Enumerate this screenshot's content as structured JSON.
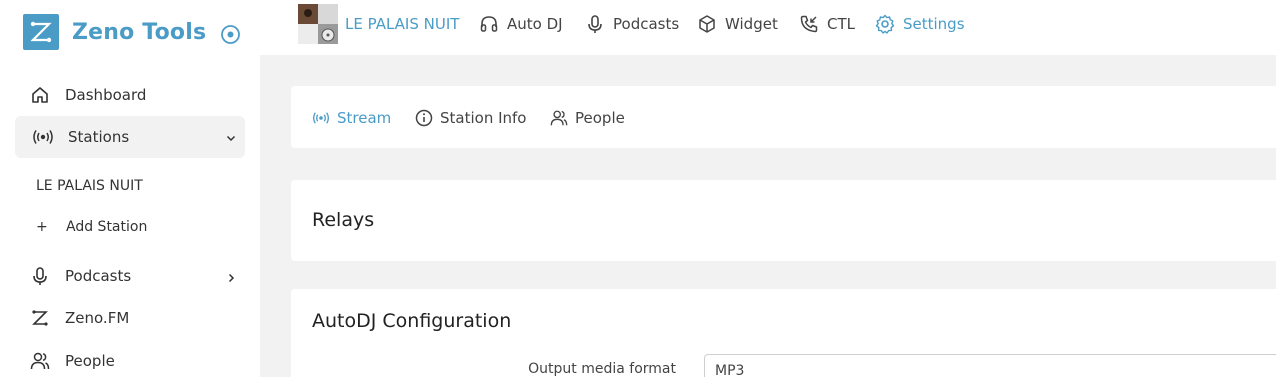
{
  "brand": {
    "name": "Zeno Tools"
  },
  "sidebar": {
    "items": [
      {
        "label": "Dashboard",
        "icon": "home-icon"
      },
      {
        "label": "Stations",
        "icon": "broadcast-icon"
      },
      {
        "label": "Podcasts",
        "icon": "microphone-icon"
      },
      {
        "label": "Zeno.FM",
        "icon": "zeno-logo-icon"
      },
      {
        "label": "People",
        "icon": "people-icon"
      }
    ],
    "station_name": "LE PALAIS NUIT",
    "add_station_plus": "+",
    "add_station": "Add Station"
  },
  "topbar": {
    "station": "LE PALAIS NUIT",
    "links": [
      {
        "label": "Auto DJ",
        "icon": "headphones-icon"
      },
      {
        "label": "Podcasts",
        "icon": "microphone-icon"
      },
      {
        "label": "Widget",
        "icon": "cube-icon"
      },
      {
        "label": "CTL",
        "icon": "phone-incoming-icon"
      },
      {
        "label": "Settings",
        "icon": "gear-icon"
      }
    ]
  },
  "tabs": [
    {
      "label": "Stream",
      "icon": "broadcast-icon"
    },
    {
      "label": "Station Info",
      "icon": "info-icon"
    },
    {
      "label": "People",
      "icon": "people-icon"
    }
  ],
  "relays": {
    "title": "Relays"
  },
  "autodj": {
    "title": "AutoDJ Configuration",
    "output_label": "Output media format",
    "output_value": "MP3"
  },
  "colors": {
    "accent": "#4a9cc7",
    "background": "#f2f2f2",
    "text": "#333333"
  }
}
